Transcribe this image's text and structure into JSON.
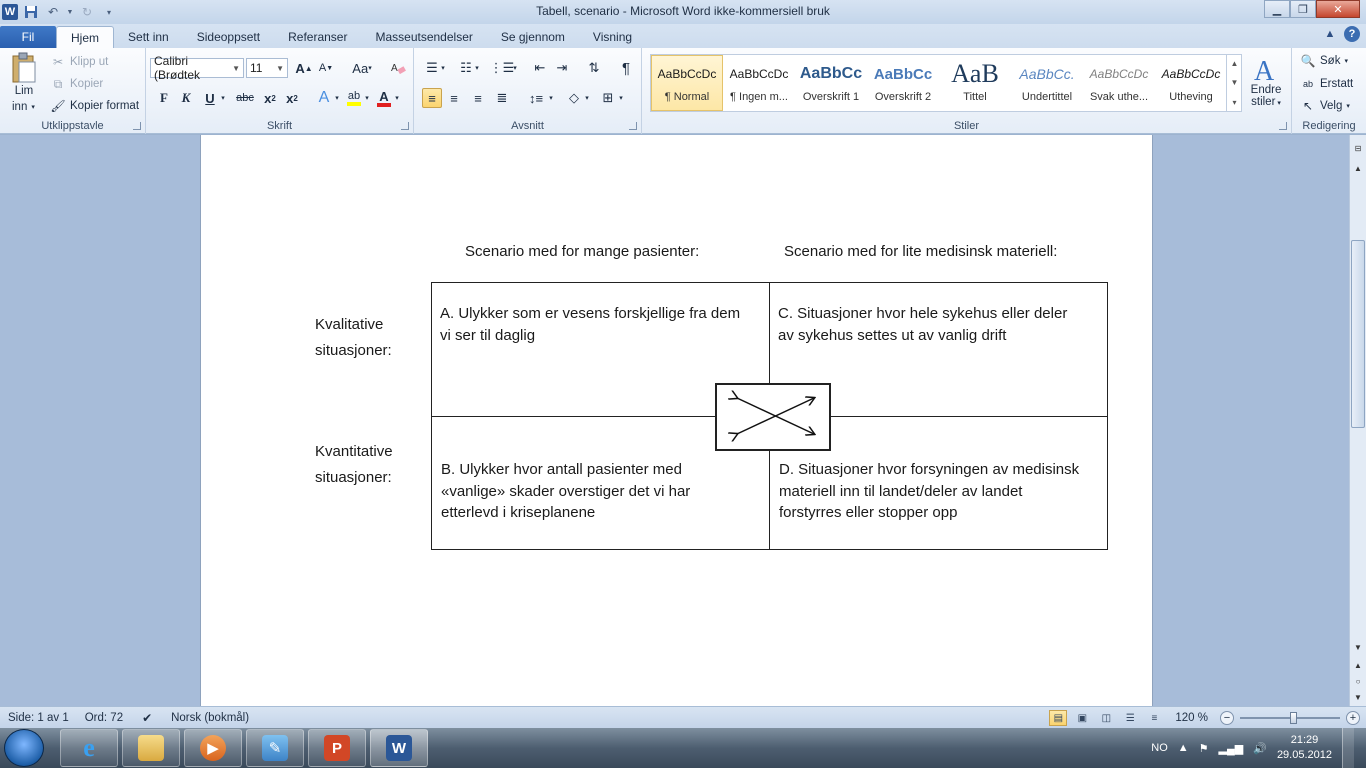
{
  "window": {
    "title": "Tabell, scenario  -  Microsoft Word ikke-kommersiell bruk",
    "app_icon": "W"
  },
  "ribbon_tabs": [
    {
      "label": "Fil"
    },
    {
      "label": "Hjem"
    },
    {
      "label": "Sett inn"
    },
    {
      "label": "Sideoppsett"
    },
    {
      "label": "Referanser"
    },
    {
      "label": "Masseutsendelser"
    },
    {
      "label": "Se gjennom"
    },
    {
      "label": "Visning"
    }
  ],
  "clipboard": {
    "paste_label_1": "Lim",
    "paste_label_2": "inn",
    "cut": "Klipp ut",
    "copy": "Kopier",
    "format_painter": "Kopier format",
    "group_label": "Utklippstavle"
  },
  "font": {
    "font_name": "Calibri (Brødtek",
    "font_size": "11",
    "group_label": "Skrift",
    "bold": "F",
    "italic": "K",
    "underline": "U",
    "strike": "abc",
    "grow": "A",
    "shrink": "A",
    "case": "Aa",
    "highlight": "ab",
    "color": "A"
  },
  "paragraph": {
    "group_label": "Avsnitt"
  },
  "styles": {
    "group_label": "Stiler",
    "items": [
      {
        "preview": "AaBbCcDc",
        "name": "¶ Normal"
      },
      {
        "preview": "AaBbCcDc",
        "name": "¶ Ingen m..."
      },
      {
        "preview": "AaBbCc",
        "name": "Overskrift 1"
      },
      {
        "preview": "AaBbCc",
        "name": "Overskrift 2"
      },
      {
        "preview": "AaB",
        "name": "Tittel"
      },
      {
        "preview": "AaBbCc.",
        "name": "Undertittel"
      },
      {
        "preview": "AaBbCcDc",
        "name": "Svak uthe..."
      },
      {
        "preview": "AaBbCcDc",
        "name": "Utheving"
      }
    ],
    "change_styles_1": "Endre",
    "change_styles_2": "stiler"
  },
  "editing": {
    "group_label": "Redigering",
    "find": "Søk",
    "replace": "Erstatt",
    "select": "Velg"
  },
  "document": {
    "header_left": "Scenario med for mange pasienter:",
    "header_right": "Scenario med for lite medisinsk materiell:",
    "row1_label_1": "Kvalitative",
    "row1_label_2": "situasjoner:",
    "row2_label_1": "Kvantitative",
    "row2_label_2": "situasjoner:",
    "cell_a_1": "A. Ulykker som er vesens forskjellige fra dem",
    "cell_a_2": "vi ser til daglig",
    "cell_c_1": "C. Situasjoner hvor hele sykehus eller deler",
    "cell_c_2": "av sykehus settes ut av vanlig drift",
    "cell_b_1": "B. Ulykker hvor antall pasienter med",
    "cell_b_2": "«vanlige» skader overstiger det vi har",
    "cell_b_3": "etterlevd i kriseplanene",
    "cell_d_1": "D. Situasjoner hvor forsyningen av medisinsk",
    "cell_d_2": "materiell inn til landet/deler av landet",
    "cell_d_3": "forstyrres eller stopper opp"
  },
  "statusbar": {
    "page": "Side: 1 av 1",
    "words": "Ord: 72",
    "language": "Norsk (bokmål)",
    "zoom": "120 %"
  },
  "taskbar": {
    "language": "NO",
    "time": "21:29",
    "date": "29.05.2012"
  },
  "colors": {
    "accent": "#2b5797",
    "file_tab": "#2a5faf",
    "selected_style": "#fde7a6"
  }
}
